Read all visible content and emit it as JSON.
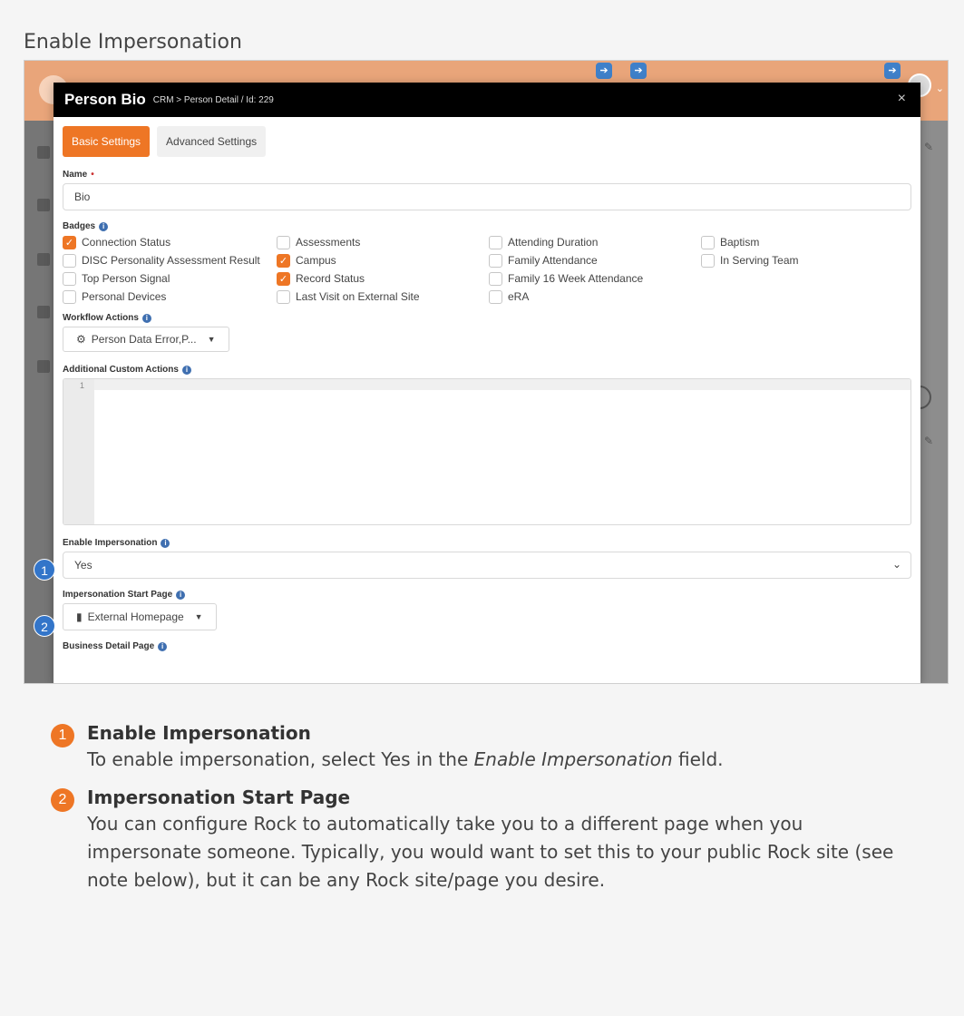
{
  "section_title": "Enable Impersonation",
  "colors": {
    "accent": "#ee7625",
    "callout_blue": "#3375c9",
    "modal_header": "#000000"
  },
  "modal": {
    "title": "Person Bio",
    "breadcrumb": "CRM > Person Detail / Id: 229",
    "close": "×"
  },
  "tabs": [
    {
      "label": "Basic Settings",
      "active": true
    },
    {
      "label": "Advanced Settings",
      "active": false
    }
  ],
  "form": {
    "name_label": "Name",
    "name_required": "•",
    "name_value": "Bio",
    "badges_label": "Badges",
    "badges": [
      {
        "label": "Connection Status",
        "checked": true
      },
      {
        "label": "Assessments",
        "checked": false
      },
      {
        "label": "Attending Duration",
        "checked": false
      },
      {
        "label": "Baptism",
        "checked": false
      },
      {
        "label": "DISC Personality Assessment Result",
        "checked": false
      },
      {
        "label": "Campus",
        "checked": true
      },
      {
        "label": "Family Attendance",
        "checked": false
      },
      {
        "label": "In Serving Team",
        "checked": false
      },
      {
        "label": "Top Person Signal",
        "checked": false
      },
      {
        "label": "Record Status",
        "checked": true
      },
      {
        "label": "Family 16 Week Attendance",
        "checked": false
      },
      {
        "label": "",
        "checked": null
      },
      {
        "label": "Personal Devices",
        "checked": false
      },
      {
        "label": "Last Visit on External Site",
        "checked": false
      },
      {
        "label": "eRA",
        "checked": false
      },
      {
        "label": "",
        "checked": null
      }
    ],
    "workflow_label": "Workflow Actions",
    "workflow_value": "Person Data Error,P...",
    "custom_actions_label": "Additional Custom Actions",
    "code_line": "1",
    "impersonation_label": "Enable Impersonation",
    "impersonation_value": "Yes",
    "start_page_label": "Impersonation Start Page",
    "start_page_value": "External Homepage",
    "business_label": "Business Detail Page"
  },
  "callouts": [
    "1",
    "2"
  ],
  "notes": [
    {
      "number": "1",
      "title": "Enable Impersonation",
      "text_before": "To enable impersonation, select Yes in the ",
      "text_em": "Enable Impersonation",
      "text_after": " field."
    },
    {
      "number": "2",
      "title": "Impersonation Start Page",
      "text_before": "You can configure Rock to automatically take you to a different page when you impersonate someone. Typically, you would want to set this to your public Rock site (see note below), but it can be any Rock site/page you desire.",
      "text_em": "",
      "text_after": ""
    }
  ]
}
